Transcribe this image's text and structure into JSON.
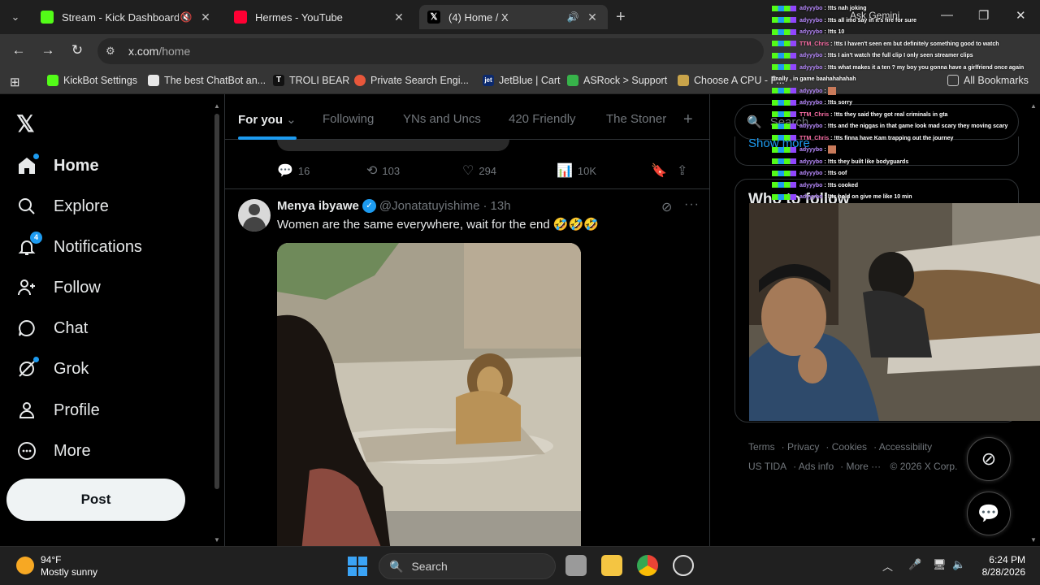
{
  "browser": {
    "tabs": [
      {
        "title": "Stream - Kick Dashboard",
        "favicon_color": "#53fc18",
        "audio": "muted"
      },
      {
        "title": "Hermes - YouTube",
        "favicon_color": "#ff0033",
        "audio": ""
      },
      {
        "title": "(4) Home / X",
        "favicon_color": "#000000",
        "audio": "playing"
      }
    ],
    "url_domain": "x.com",
    "url_path": "/home",
    "bookmarks": [
      {
        "label": "KickBot Settings"
      },
      {
        "label": "The best ChatBot an..."
      },
      {
        "label": "TROLI BEAR"
      },
      {
        "label": "Private Search Engi..."
      },
      {
        "label": "JetBlue | Cart"
      },
      {
        "label": "ASRock > Support"
      },
      {
        "label": "Choose A CPU - P..."
      }
    ],
    "all_bookmarks": "All Bookmarks"
  },
  "x": {
    "nav": {
      "home": "Home",
      "explore": "Explore",
      "notifications": "Notifications",
      "notifications_badge": "4",
      "follow": "Follow",
      "chat": "Chat",
      "grok": "Grok",
      "profile": "Profile",
      "more": "More",
      "post": "Post"
    },
    "feed_tabs": [
      "For you",
      "Following",
      "YNs and Uncs",
      "420 Friendly",
      "The Stoner"
    ],
    "prev_tweet_actions": {
      "replies": "16",
      "reposts": "103",
      "likes": "294",
      "views": "10K"
    },
    "tweet": {
      "name": "Menya ibyawe",
      "handle": "@Jonatatuyishime",
      "time": "13h",
      "text": "Women are the same everywhere, wait for the end 🤣🤣🤣"
    },
    "search_placeholder": "Search",
    "show_more": "Show more",
    "who_to_follow": "Who to follow",
    "footer": [
      "Terms",
      "Privacy",
      "Cookies",
      "Accessibility",
      "US TIDA",
      "Ads info",
      "More ···",
      "© 2026 X Corp."
    ]
  },
  "overlay": {
    "ask_gemini": "Ask Gemini",
    "chat": [
      {
        "user": "adyyybo",
        "color": "#b98bff",
        "msg": "!tts nah joking"
      },
      {
        "user": "adyyybo",
        "color": "#b98bff",
        "msg": "!tts all imo say in it's fire for sure"
      },
      {
        "user": "adyyybo",
        "color": "#b98bff",
        "msg": "!tts 10"
      },
      {
        "user": "TTM_Chris",
        "color": "#ff6fa8",
        "msg": "!tts I haven't seen em but definitely something good to watch"
      },
      {
        "user": "adyyybo",
        "color": "#b98bff",
        "msg": "!tts I ain't watch the full clip I only seen streamer clips"
      },
      {
        "user": "adyyybo",
        "color": "#b98bff",
        "msg": "!tts what makes it a ten ? my boy you gonna have a girlfriend once again"
      },
      {
        "user": "",
        "color": "#ffffff",
        "msg": "finally , in game baahahahahah"
      },
      {
        "user": "adyyybo",
        "color": "#b98bff",
        "msg": ""
      },
      {
        "user": "adyyybo",
        "color": "#b98bff",
        "msg": "!tts sorry"
      },
      {
        "user": "TTM_Chris",
        "color": "#ff6fa8",
        "msg": "!tts they said they got real criminals in gta"
      },
      {
        "user": "adyyybo",
        "color": "#b98bff",
        "msg": "!tts and the niggas in that game look mad scary they moving scary"
      },
      {
        "user": "TTM_Chris",
        "color": "#ff6fa8",
        "msg": "!tts finna have Kam trapping out the journey"
      },
      {
        "user": "adyyybo",
        "color": "#b98bff",
        "msg": ""
      },
      {
        "user": "adyyybo",
        "color": "#b98bff",
        "msg": "!tts they built like bodyguards"
      },
      {
        "user": "adyyybo",
        "color": "#b98bff",
        "msg": "!tts oof"
      },
      {
        "user": "adyyybo",
        "color": "#b98bff",
        "msg": "!tts cooked"
      },
      {
        "user": "adyyybo",
        "color": "#b98bff",
        "msg": "!tts hold on give me like 10 min"
      }
    ]
  },
  "taskbar": {
    "temp": "94°F",
    "weather": "Mostly sunny",
    "search": "Search",
    "time": "6:24 PM",
    "date": "8/28/2026"
  }
}
